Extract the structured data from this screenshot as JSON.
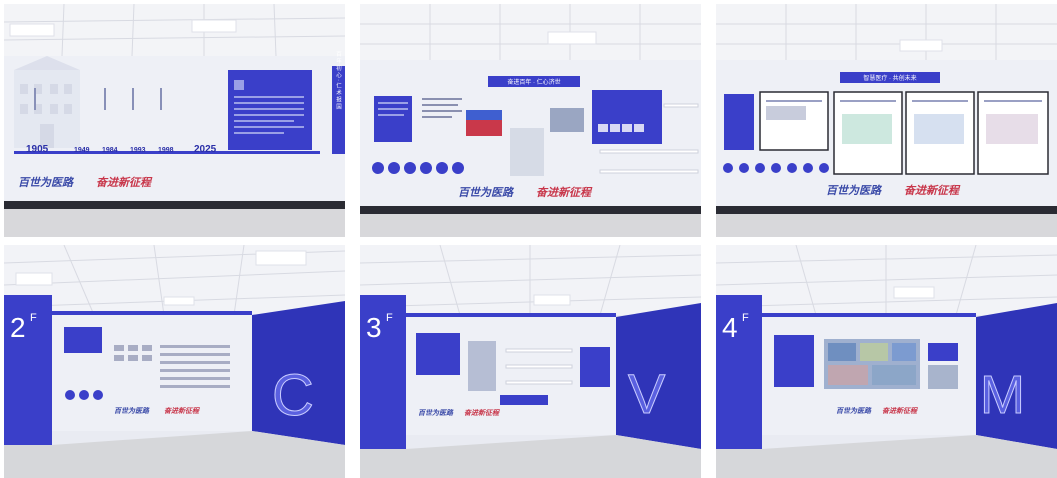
{
  "panels": [
    {
      "id": "panel-1",
      "slogan_left": "百世为医路",
      "slogan_right": "奋进新征程",
      "timeline_years": [
        "1905",
        "1949",
        "1984",
        "1993",
        "1998",
        "2025"
      ],
      "header_vertical": "百 年 初 心 · 仁 术 报 国"
    },
    {
      "id": "panel-2",
      "header_banner": "奋进百年 · 仁心济世",
      "slogan_left": "百世为医路",
      "slogan_right": "奋进新征程"
    },
    {
      "id": "panel-3",
      "header_banner": "智慧医疗 · 共创未来",
      "slogan_left": "百世为医路",
      "slogan_right": "奋进新征程"
    },
    {
      "id": "panel-4",
      "floor_label": "2F",
      "floor_number": "2",
      "floor_sup": "F",
      "big_letter": "C",
      "slogan_left": "百世为医路",
      "slogan_right": "奋进新征程"
    },
    {
      "id": "panel-5",
      "floor_label": "3F",
      "floor_number": "3",
      "floor_sup": "F",
      "big_letter": "V",
      "slogan_left": "百世为医路",
      "slogan_right": "奋进新征程"
    },
    {
      "id": "panel-6",
      "floor_label": "4F",
      "floor_number": "4",
      "floor_sup": "F",
      "big_letter": "M",
      "slogan_left": "百世为医路",
      "slogan_right": "奋进新征程"
    }
  ],
  "colors": {
    "accent_blue": "#3a3fc9",
    "deep_blue": "#2a2fa8",
    "slogan_blue": "#3a4aa8",
    "slogan_red": "#c8364a",
    "ceiling": "#f1f2f6",
    "floor": "#d9d9dc"
  }
}
